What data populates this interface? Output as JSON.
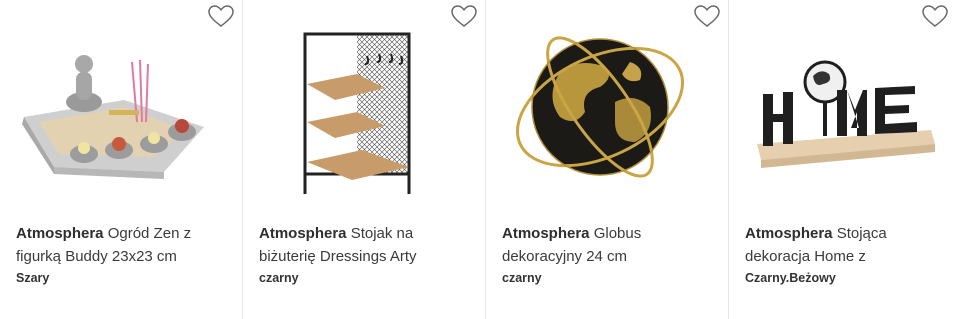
{
  "products": [
    {
      "brand": "Atmosphera",
      "name": "Ogród Zen z figurką Buddy 23x23 cm",
      "color": "Szary",
      "image_icon": "zen-garden-image"
    },
    {
      "brand": "Atmosphera",
      "name": "Stojak na biżuterię Dressings Arty",
      "color": "czarny",
      "image_icon": "jewelry-stand-image"
    },
    {
      "brand": "Atmosphera",
      "name": "Globus dekoracyjny 24 cm",
      "color": "czarny",
      "image_icon": "globe-image"
    },
    {
      "brand": "Atmosphera",
      "name": "Stojąca dekoracja Home z",
      "color": "Czarny.Beżowy",
      "image_icon": "home-decoration-image"
    }
  ]
}
